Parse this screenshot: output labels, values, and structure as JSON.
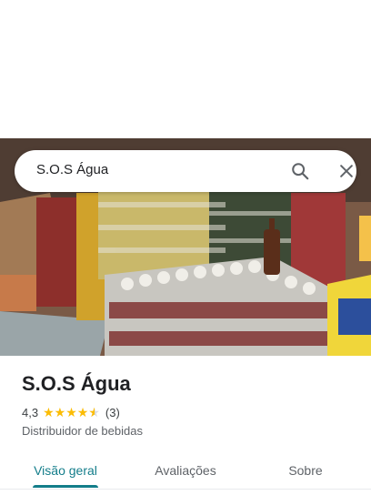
{
  "search": {
    "query": "S.O.S Água"
  },
  "place": {
    "name": "S.O.S Água",
    "rating": "4,3",
    "rating_value": 4.3,
    "review_count": "(3)",
    "category": "Distribuidor de bebidas"
  },
  "tabs": [
    {
      "label": "Visão geral",
      "active": true
    },
    {
      "label": "Avaliações",
      "active": false
    },
    {
      "label": "Sobre",
      "active": false
    }
  ],
  "colors": {
    "accent": "#137d8a",
    "star": "#fbbc04",
    "text": "#202124",
    "secondary_text": "#5f6368"
  },
  "icons": {
    "search": "search-icon",
    "close": "close-icon",
    "star": "star-icon"
  }
}
